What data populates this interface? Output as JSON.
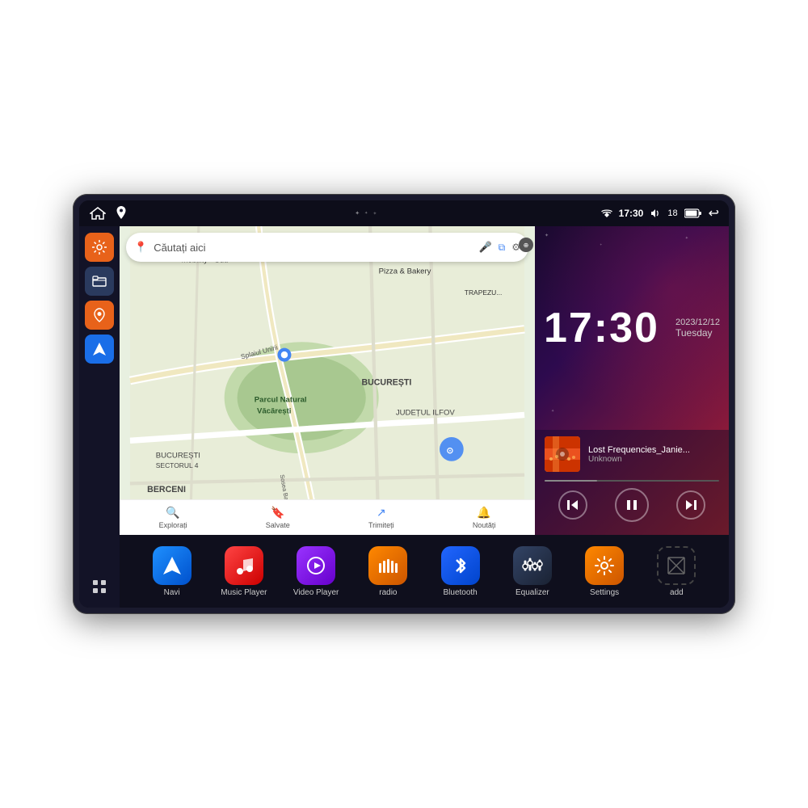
{
  "device": {
    "status_bar": {
      "time": "17:30",
      "signal": "18",
      "left_icons": [
        "home",
        "map-pin"
      ]
    },
    "clock": {
      "time": "17:30",
      "date": "2023/12/12",
      "day": "Tuesday"
    },
    "map": {
      "search_placeholder": "Căutați aici",
      "locations": [
        "AXIS Premium Mobility - Sud",
        "Pizza & Bakery",
        "Parcul Natural Văcărești",
        "BUCUREȘTI",
        "BUCUREȘTI SECTORUL 4",
        "JUDEȚUL ILFOV",
        "BERCENI"
      ],
      "toolbar_items": [
        "Explorați",
        "Salvate",
        "Trimiteți",
        "Noutăți"
      ]
    },
    "music": {
      "title": "Lost Frequencies_Janie...",
      "artist": "Unknown",
      "progress": 30
    },
    "apps": [
      {
        "label": "Navi",
        "icon_type": "blue",
        "icon": "▲"
      },
      {
        "label": "Music Player",
        "icon_type": "red",
        "icon": "♪"
      },
      {
        "label": "Video Player",
        "icon_type": "purple",
        "icon": "▶"
      },
      {
        "label": "radio",
        "icon_type": "orange",
        "icon": "📻"
      },
      {
        "label": "Bluetooth",
        "icon_type": "bt-blue",
        "icon": "₿"
      },
      {
        "label": "Equalizer",
        "icon_type": "dark",
        "icon": "⊪"
      },
      {
        "label": "Settings",
        "icon_type": "gear-orange",
        "icon": "⚙"
      },
      {
        "label": "add",
        "icon_type": "add-gray",
        "icon": "+"
      }
    ],
    "sidebar": [
      {
        "icon": "⚙",
        "color": "orange"
      },
      {
        "icon": "▬",
        "color": "darkblue"
      },
      {
        "icon": "📍",
        "color": "orange2"
      },
      {
        "icon": "▲",
        "color": "nav"
      }
    ]
  }
}
